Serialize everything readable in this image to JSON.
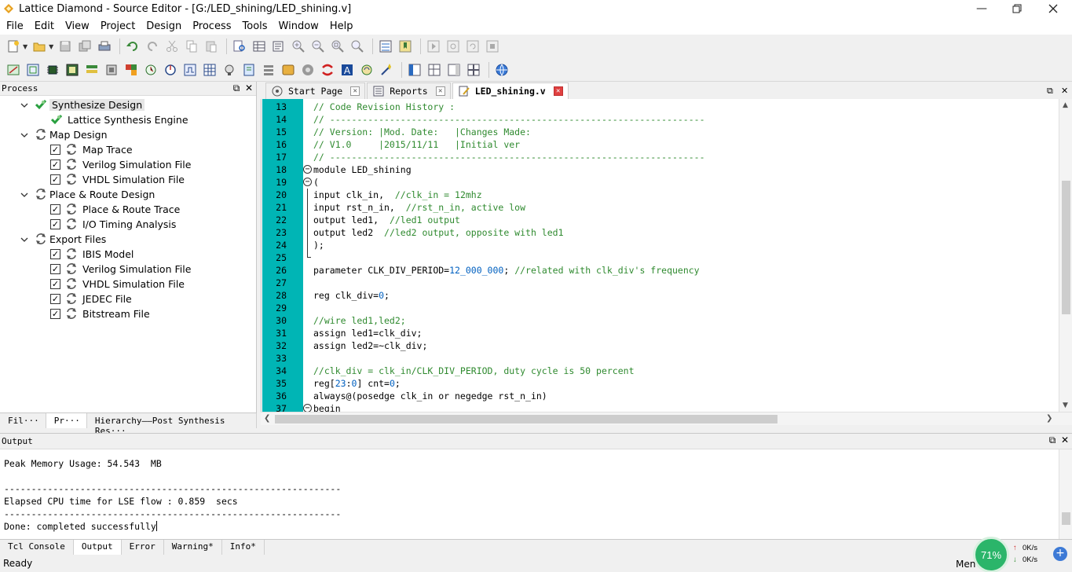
{
  "window": {
    "title": "Lattice Diamond - Source Editor - [G:/LED_shining/LED_shining.v]",
    "icon": "lattice-diamond-icon"
  },
  "menu": [
    "File",
    "Edit",
    "View",
    "Project",
    "Design",
    "Process",
    "Tools",
    "Window",
    "Help"
  ],
  "process_panel": {
    "title": "Process",
    "tree": [
      {
        "level": 0,
        "expand": true,
        "icon": "synthesize-check-icon",
        "label": "Synthesize Design",
        "selected": true
      },
      {
        "level": 1,
        "checkbox": false,
        "icon": "synthesize-check-icon",
        "label": "Lattice Synthesis Engine"
      },
      {
        "level": 0,
        "expand": true,
        "icon": "refresh-icon",
        "label": "Map Design"
      },
      {
        "level": 1,
        "checkbox": true,
        "icon": "refresh-icon",
        "label": "Map Trace"
      },
      {
        "level": 1,
        "checkbox": true,
        "icon": "refresh-icon",
        "label": "Verilog Simulation File"
      },
      {
        "level": 1,
        "checkbox": true,
        "icon": "refresh-icon",
        "label": "VHDL Simulation File"
      },
      {
        "level": 0,
        "expand": true,
        "icon": "refresh-icon",
        "label": "Place & Route Design"
      },
      {
        "level": 1,
        "checkbox": true,
        "icon": "refresh-icon",
        "label": "Place & Route Trace"
      },
      {
        "level": 1,
        "checkbox": true,
        "icon": "refresh-icon",
        "label": "I/O Timing Analysis"
      },
      {
        "level": 0,
        "expand": true,
        "icon": "refresh-icon",
        "label": "Export Files"
      },
      {
        "level": 1,
        "checkbox": true,
        "icon": "refresh-icon",
        "label": "IBIS Model"
      },
      {
        "level": 1,
        "checkbox": true,
        "icon": "refresh-icon",
        "label": "Verilog Simulation File"
      },
      {
        "level": 1,
        "checkbox": true,
        "icon": "refresh-icon",
        "label": "VHDL Simulation File"
      },
      {
        "level": 1,
        "checkbox": true,
        "icon": "refresh-icon",
        "label": "JEDEC File"
      },
      {
        "level": 1,
        "checkbox": true,
        "icon": "refresh-icon",
        "label": "Bitstream File"
      }
    ],
    "tabs": [
      {
        "label": "Fil···",
        "active": false
      },
      {
        "label": "Pr···",
        "active": true
      },
      {
        "label": "Hierarchy——Post Synthesis Res···",
        "active": false
      }
    ]
  },
  "editor": {
    "tabs": [
      {
        "label": "Start Page",
        "icon": "start-page-icon",
        "active": false
      },
      {
        "label": "Reports",
        "icon": "reports-icon",
        "active": false
      },
      {
        "label": "LED_shining.v",
        "icon": "edit-file-icon",
        "active": true
      }
    ],
    "lines": [
      {
        "n": "13",
        "segs": [
          {
            "t": "// Code Revision History :",
            "c": "com"
          }
        ]
      },
      {
        "n": "14",
        "segs": [
          {
            "t": "// ---------------------------------------------------------------------",
            "c": "com"
          }
        ]
      },
      {
        "n": "15",
        "segs": [
          {
            "t": "// Version: |Mod. Date:   |Changes Made:",
            "c": "com"
          }
        ]
      },
      {
        "n": "16",
        "segs": [
          {
            "t": "// V1.0     |2015/11/11   |Initial ver",
            "c": "com"
          }
        ]
      },
      {
        "n": "17",
        "segs": [
          {
            "t": "// ---------------------------------------------------------------------",
            "c": "com"
          }
        ]
      },
      {
        "n": "18",
        "fold": "start",
        "segs": [
          {
            "t": "module LED_shining",
            "c": "kw"
          }
        ]
      },
      {
        "n": "19",
        "fold": "start2",
        "segs": [
          {
            "t": "(",
            "c": "kw"
          }
        ]
      },
      {
        "n": "20",
        "fold": "bar",
        "segs": [
          {
            "t": "input clk_in,  ",
            "c": "kw"
          },
          {
            "t": "//clk_in = 12mhz",
            "c": "com"
          }
        ]
      },
      {
        "n": "21",
        "fold": "bar",
        "segs": [
          {
            "t": "input rst_n_in,  ",
            "c": "kw"
          },
          {
            "t": "//rst_n_in, active low",
            "c": "com"
          }
        ]
      },
      {
        "n": "22",
        "fold": "bar",
        "segs": [
          {
            "t": "output led1,  ",
            "c": "kw"
          },
          {
            "t": "//led1 output",
            "c": "com"
          }
        ]
      },
      {
        "n": "23",
        "fold": "bar",
        "segs": [
          {
            "t": "output led2  ",
            "c": "kw"
          },
          {
            "t": "//led2 output, opposite with led1",
            "c": "com"
          }
        ]
      },
      {
        "n": "24",
        "fold": "bar",
        "segs": [
          {
            "t": ");",
            "c": "kw"
          }
        ]
      },
      {
        "n": "25",
        "fold": "end",
        "segs": []
      },
      {
        "n": "26",
        "segs": [
          {
            "t": "parameter CLK_DIV_PERIOD=",
            "c": "kw"
          },
          {
            "t": "12_000_000",
            "c": "num"
          },
          {
            "t": "; ",
            "c": "kw"
          },
          {
            "t": "//related with clk_div's frequency",
            "c": "com"
          }
        ]
      },
      {
        "n": "27",
        "segs": []
      },
      {
        "n": "28",
        "segs": [
          {
            "t": "reg clk_div=",
            "c": "kw"
          },
          {
            "t": "0",
            "c": "num"
          },
          {
            "t": ";",
            "c": "kw"
          }
        ]
      },
      {
        "n": "29",
        "segs": []
      },
      {
        "n": "30",
        "segs": [
          {
            "t": "//wire led1,led2;",
            "c": "com"
          }
        ]
      },
      {
        "n": "31",
        "segs": [
          {
            "t": "assign led1=clk_div;",
            "c": "kw"
          }
        ]
      },
      {
        "n": "32",
        "segs": [
          {
            "t": "assign led2=~clk_div;",
            "c": "kw"
          }
        ]
      },
      {
        "n": "33",
        "segs": []
      },
      {
        "n": "34",
        "segs": [
          {
            "t": "//clk_div = clk_in/CLK_DIV_PERIOD, duty cycle is 50 percent",
            "c": "com"
          }
        ]
      },
      {
        "n": "35",
        "segs": [
          {
            "t": "reg[",
            "c": "kw"
          },
          {
            "t": "23",
            "c": "num"
          },
          {
            "t": ":",
            "c": "kw"
          },
          {
            "t": "0",
            "c": "num"
          },
          {
            "t": "] cnt=",
            "c": "kw"
          },
          {
            "t": "0",
            "c": "num"
          },
          {
            "t": ";",
            "c": "kw"
          }
        ]
      },
      {
        "n": "36",
        "segs": [
          {
            "t": "always@(posedge clk_in or negedge rst_n_in)",
            "c": "kw"
          }
        ]
      },
      {
        "n": "37",
        "fold": "start",
        "segs": [
          {
            "t": "begin",
            "c": "kw"
          }
        ]
      }
    ]
  },
  "output_panel": {
    "title": "Output",
    "lines": [
      "",
      "Peak Memory Usage: 54.543  MB",
      "",
      "--------------------------------------------------------------",
      "Elapsed CPU time for LSE flow : 0.859  secs",
      "--------------------------------------------------------------",
      "Done: completed successfully"
    ],
    "tabs": [
      {
        "label": "Tcl Console",
        "active": false
      },
      {
        "label": "Output",
        "active": true
      },
      {
        "label": "Error",
        "active": false
      },
      {
        "label": "Warning*",
        "active": false
      },
      {
        "label": "Info*",
        "active": false
      }
    ]
  },
  "status": {
    "text": "Ready",
    "memory_label": "Men",
    "memory_percent": "71%",
    "upload": "0K/s",
    "download": "0K/s"
  },
  "colors": {
    "gutter": "#00b5b5",
    "comment": "#2f8a2f",
    "number": "#0060c0",
    "memory_widget": "#2bb56a"
  }
}
